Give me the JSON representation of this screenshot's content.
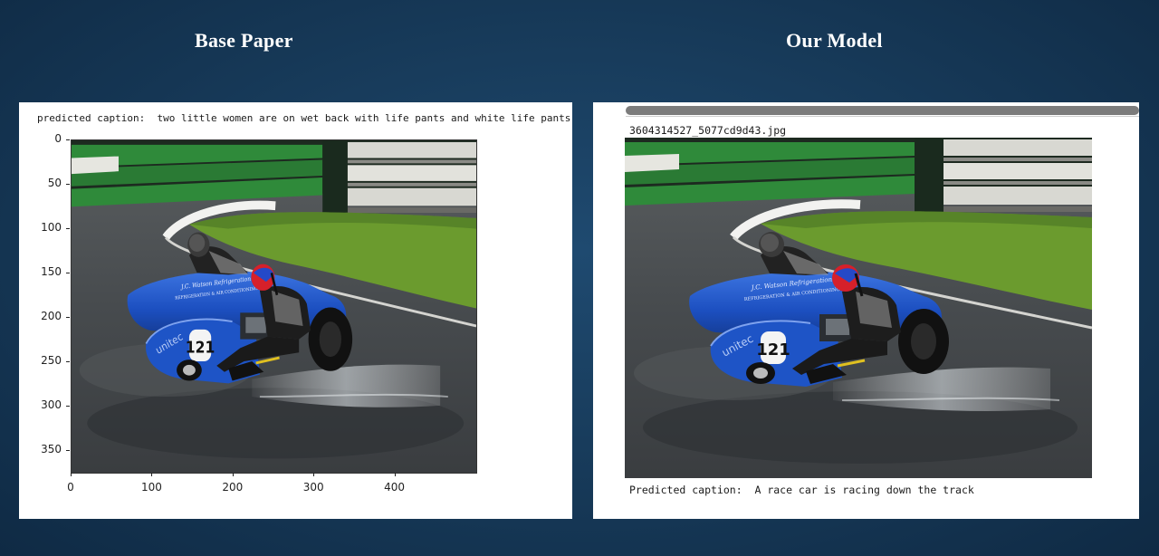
{
  "slide": {
    "left_title": "Base Paper",
    "right_title": "Our Model"
  },
  "left_panel": {
    "caption": "predicted caption:  two little women are on wet back with life pants and white life pants",
    "y_ticks": [
      "0",
      "50",
      "100",
      "150",
      "200",
      "250",
      "300",
      "350"
    ],
    "x_ticks": [
      "0",
      "100",
      "200",
      "300",
      "400"
    ]
  },
  "right_panel": {
    "filename": "3604314527_5077cd9d43.jpg",
    "caption": "Predicted caption:  A race car is racing down the track"
  },
  "photo": {
    "subject": "sidecar racing motorcycle on wet track",
    "livery_line1": "J.C. Watson Refrigeration Ltd",
    "livery_line2": "REFRIGERATION & AIR CONDITIONING",
    "brand": "unitec",
    "race_number": "121",
    "colors": {
      "body": "#1f56c8",
      "grass": "#6b9b2e",
      "track": "#4b4f52",
      "barrier_green": "#2f8a3a",
      "helmet": "#d6202a"
    }
  }
}
